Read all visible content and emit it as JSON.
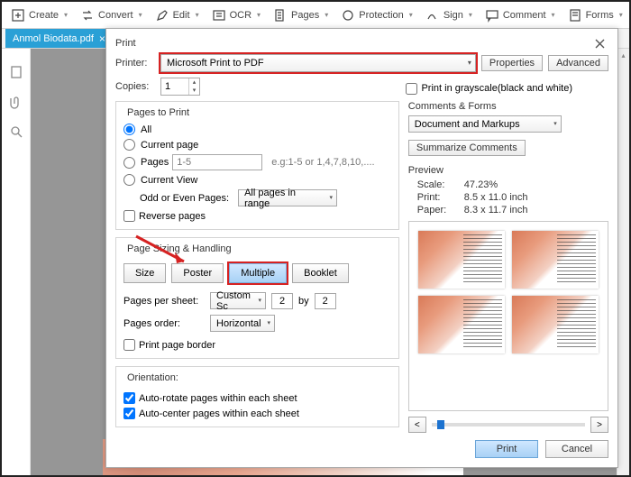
{
  "topbar": {
    "create": "Create",
    "convert": "Convert",
    "edit": "Edit",
    "ocr": "OCR",
    "pages": "Pages",
    "protection": "Protection",
    "sign": "Sign",
    "comment": "Comment",
    "forms": "Forms"
  },
  "filetab": {
    "name": "Anmol Biodata.pdf"
  },
  "dialog": {
    "title": "Print",
    "printer_label": "Printer:",
    "printer_selected": "Microsoft Print to PDF",
    "properties": "Properties",
    "advanced": "Advanced",
    "copies_label": "Copies:",
    "copies_value": "1",
    "grayscale": "Print in grayscale(black and white)",
    "ptp_title": "Pages to Print",
    "ptp_all": "All",
    "ptp_current_page": "Current page",
    "ptp_pages": "Pages",
    "ptp_pages_placeholder": "1-5",
    "ptp_eg": "e.g:1-5 or 1,4,7,8,10,....",
    "ptp_current_view": "Current View",
    "odd_even_label": "Odd or Even Pages:",
    "odd_even_value": "All pages in range",
    "reverse": "Reverse pages",
    "psh_title": "Page Sizing & Handling",
    "tab_size": "Size",
    "tab_poster": "Poster",
    "tab_multiple": "Multiple",
    "tab_booklet": "Booklet",
    "pps_label": "Pages per sheet:",
    "pps_mode": "Custom Sc",
    "pps_cols": "2",
    "pps_by": "by",
    "pps_rows": "2",
    "porder_label": "Pages order:",
    "porder_value": "Horizontal",
    "ppb": "Print page border",
    "orient_title": "Orientation:",
    "orient_autorotate": "Auto-rotate pages within each sheet",
    "orient_autocenter": "Auto-center pages within each sheet",
    "cf_title": "Comments & Forms",
    "cf_value": "Document and Markups",
    "summ": "Summarize Comments",
    "preview_title": "Preview",
    "kv_scale_k": "Scale:",
    "kv_scale_v": "47.23%",
    "kv_print_k": "Print:",
    "kv_print_v": "8.5 x 11.0 inch",
    "kv_paper_k": "Paper:",
    "kv_paper_v": "8.3 x 11.7 inch",
    "prev": "<",
    "next": ">",
    "print_btn": "Print",
    "cancel_btn": "Cancel"
  }
}
